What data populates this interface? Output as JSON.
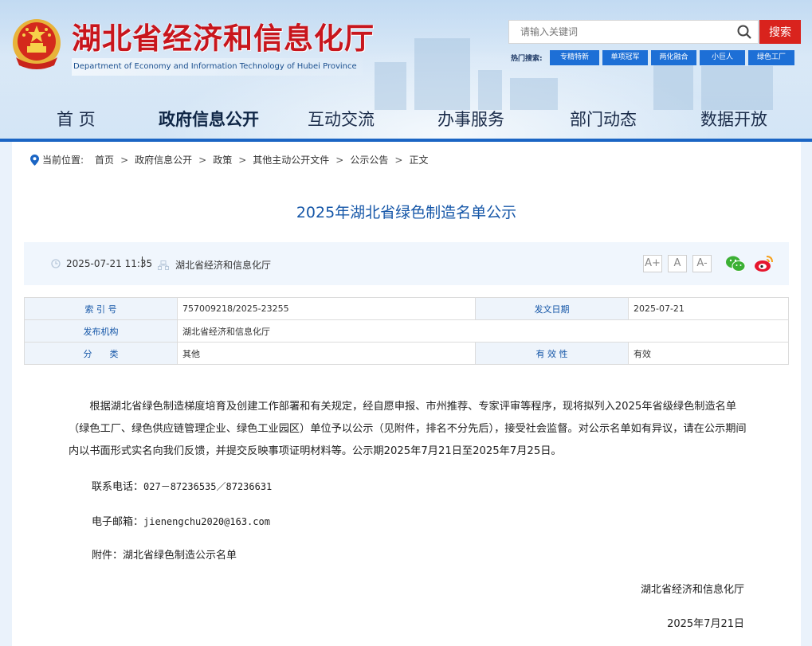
{
  "header": {
    "site_title": "湖北省经济和信息化厅",
    "site_subtitle": "Department of Economy and Information Technology of Hubei Province",
    "search": {
      "placeholder": "请输入关键词",
      "button_label": "搜索"
    },
    "hot_label": "热门搜索:",
    "hot_tags": [
      "专精特新",
      "单项冠军",
      "两化融合",
      "小巨人",
      "绿色工厂"
    ],
    "colors": {
      "title_red": "#c8161d",
      "nav_blue": "#1b65c4",
      "search_red": "#d9231d"
    }
  },
  "nav": {
    "items": [
      "首 页",
      "政府信息公开",
      "互动交流",
      "办事服务",
      "部门动态",
      "数据开放"
    ],
    "active_index": 1
  },
  "breadcrumb": {
    "label": "当前位置:",
    "items": [
      "首页",
      "政府信息公开",
      "政策",
      "其他主动公开文件",
      "公示公告",
      "正文"
    ]
  },
  "article": {
    "title": "2025年湖北省绿色制造名单公示",
    "datetime": "2025-07-21 11:35",
    "publisher": "湖北省经济和信息化厅",
    "font_sizes": [
      "A+",
      "A",
      "A-"
    ],
    "share": [
      "wechat-icon",
      "weibo-icon"
    ]
  },
  "info_table": {
    "index_label": "索 引 号",
    "index_value": "757009218/2025-23255",
    "date_label": "发文日期",
    "date_value": "2025-07-21",
    "org_label": "发布机构",
    "org_value": "湖北省经济和信息化厅",
    "category_label": "分　　类",
    "category_value": "其他",
    "validity_label": "有 效 性",
    "validity_value": "有效"
  },
  "content": {
    "paragraph": "根据湖北省绿色制造梯度培育及创建工作部署和有关规定，经自愿申报、市州推荐、专家评审等程序，现将拟列入2025年省级绿色制造名单（绿色工厂、绿色供应链管理企业、绿色工业园区）单位予以公示（见附件，排名不分先后），接受社会监督。对公示名单如有异议，请在公示期间内以书面形式实名向我们反馈，并提交反映事项证明材料等。公示期2025年7月21日至2025年7月25日。",
    "phone_label": "联系电话：",
    "phone_value": "027－87236535／87236631",
    "email_label": "电子邮箱：",
    "email_value": "jienengchu2020@163.com",
    "attachment_label": "附件：",
    "attachment_link": "湖北省绿色制造公示名单",
    "signature_org": "湖北省经济和信息化厅",
    "signature_date": "2025年7月21日"
  }
}
